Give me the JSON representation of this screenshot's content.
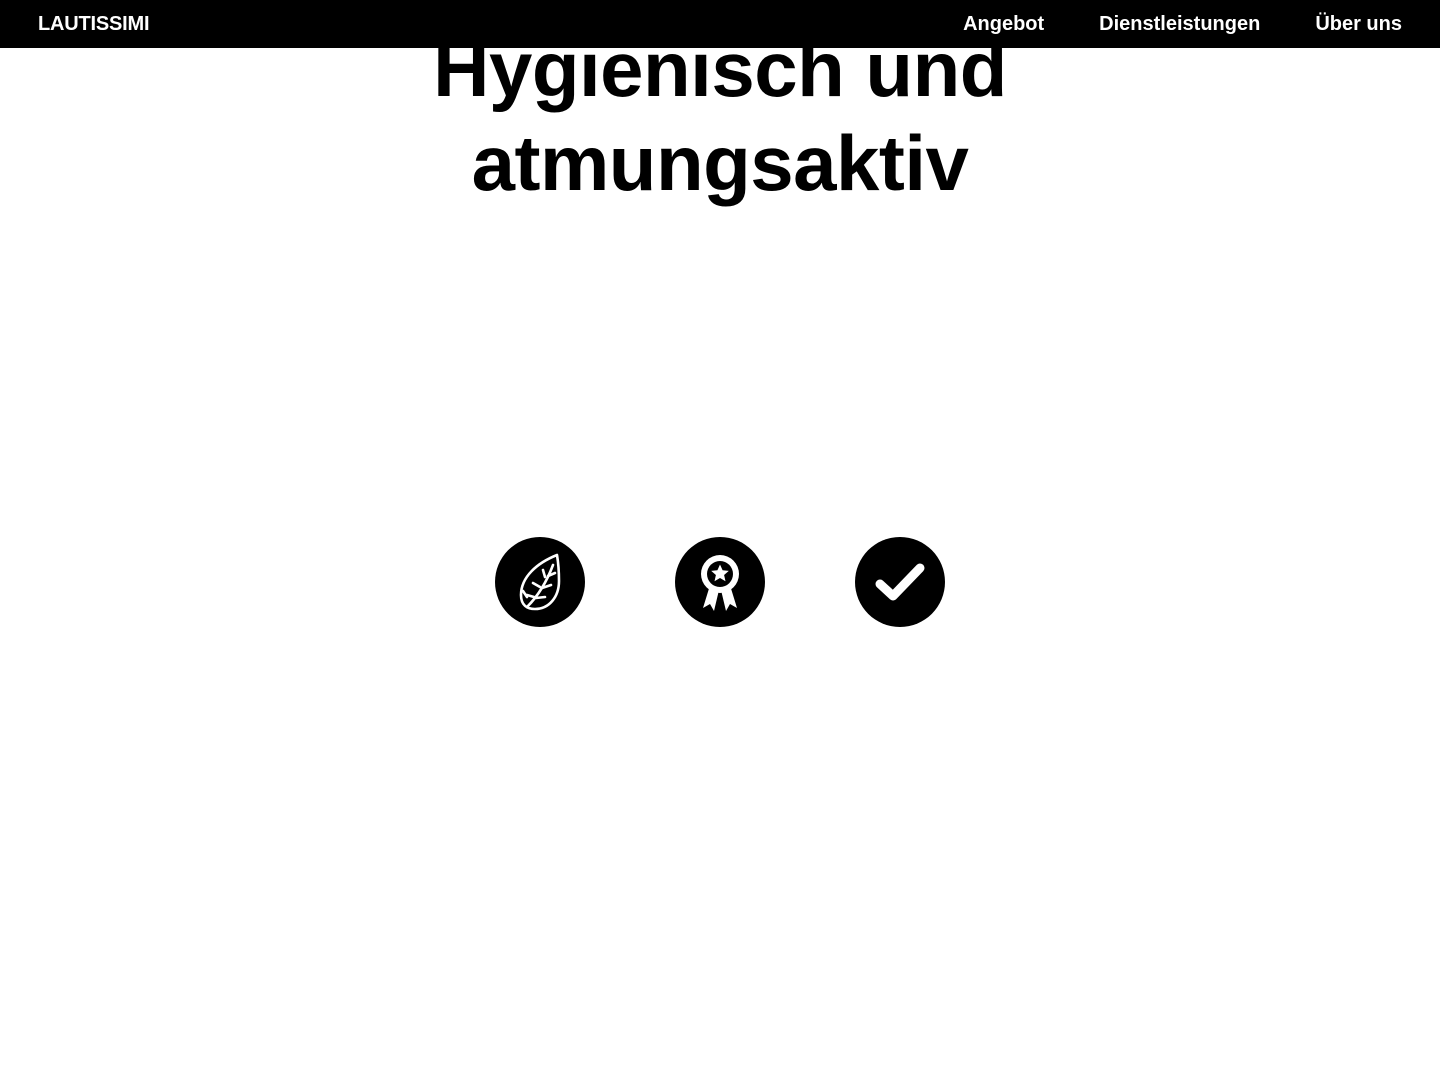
{
  "header": {
    "brand": "LAUTISSIMI",
    "nav": [
      {
        "label": "Angebot"
      },
      {
        "label": "Dienstleistungen"
      },
      {
        "label": "Über uns"
      }
    ]
  },
  "hero": {
    "title_line1": "Hygienisch und",
    "title_line2": "atmungsaktiv"
  },
  "features": [
    {
      "icon": "leaf-icon"
    },
    {
      "icon": "award-ribbon-icon"
    },
    {
      "icon": "checkmark-icon"
    }
  ],
  "colors": {
    "background": "#ffffff",
    "header_bg": "#000000",
    "header_text": "#ffffff",
    "text": "#000000",
    "icon_circle": "#000000",
    "icon_glyph": "#ffffff"
  }
}
